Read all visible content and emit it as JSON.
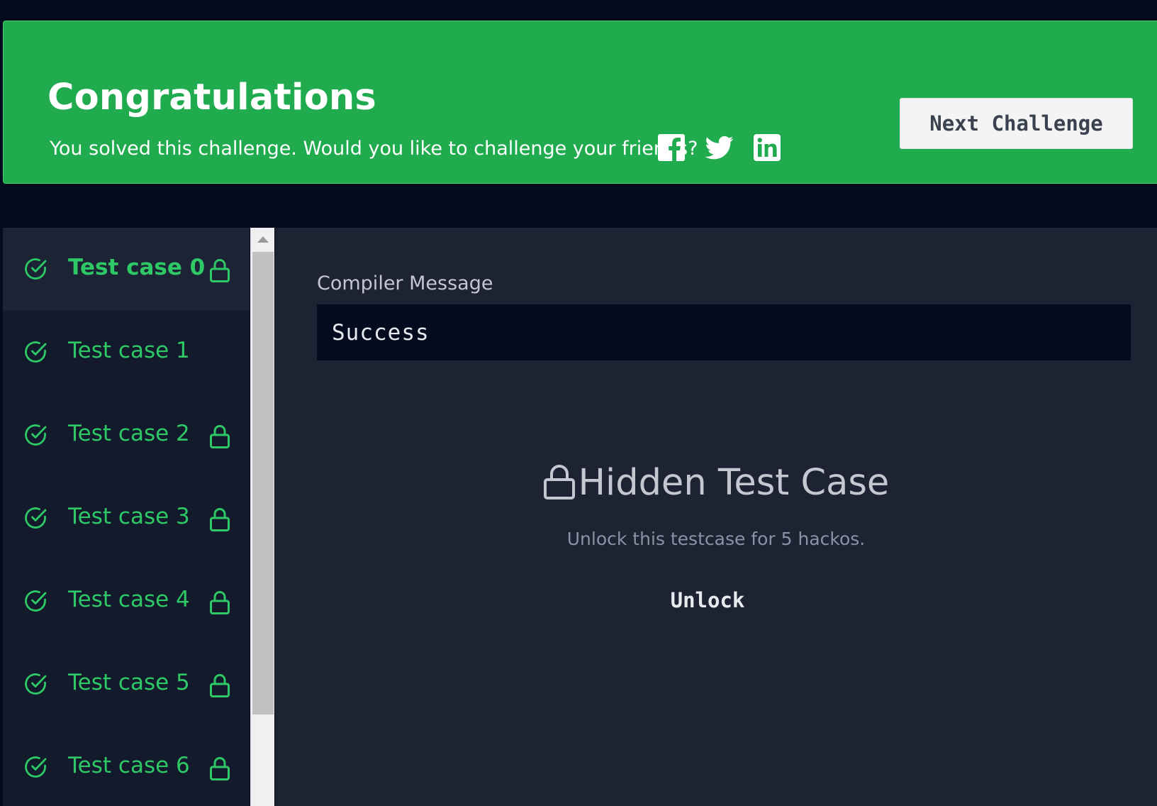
{
  "banner": {
    "title": "Congratulations",
    "subtitle": "You solved this challenge. Would you like to challenge your friends?",
    "social": [
      "facebook-icon",
      "twitter-icon",
      "linkedin-icon"
    ],
    "next_button_label": "Next Challenge",
    "background_color": "#1fab4e"
  },
  "test_cases": [
    {
      "label": "Test case 0",
      "status": "passed",
      "locked": true,
      "active": true
    },
    {
      "label": "Test case 1",
      "status": "passed",
      "locked": false,
      "active": false
    },
    {
      "label": "Test case 2",
      "status": "passed",
      "locked": true,
      "active": false
    },
    {
      "label": "Test case 3",
      "status": "passed",
      "locked": true,
      "active": false
    },
    {
      "label": "Test case 4",
      "status": "passed",
      "locked": true,
      "active": false
    },
    {
      "label": "Test case 5",
      "status": "passed",
      "locked": true,
      "active": false
    },
    {
      "label": "Test case 6",
      "status": "passed",
      "locked": true,
      "active": false
    }
  ],
  "main": {
    "compiler_label": "Compiler Message",
    "compiler_value": "Success",
    "hidden_title": "Hidden Test Case",
    "hidden_subtitle": "Unlock this testcase for 5 hackos.",
    "unlock_label": "Unlock"
  },
  "colors": {
    "accent_green": "#2ec866",
    "page_bg": "#050b1e",
    "panel_bg": "#1d2333",
    "sidebar_bg": "#121a2c"
  }
}
